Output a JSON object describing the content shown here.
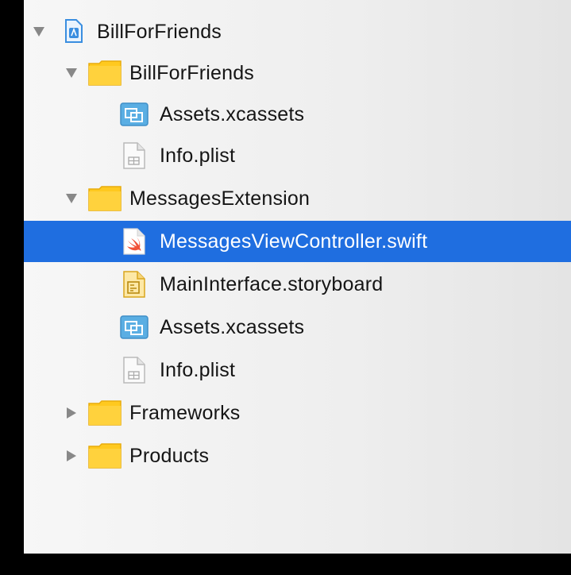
{
  "tree": {
    "project": {
      "label": "BillForFriends",
      "icon": "xcode-project-icon",
      "expanded": true
    },
    "group_app": {
      "label": "BillForFriends",
      "icon": "folder-icon",
      "expanded": true
    },
    "app_assets": {
      "label": "Assets.xcassets",
      "icon": "asset-catalog-icon"
    },
    "app_info": {
      "label": "Info.plist",
      "icon": "plist-file-icon"
    },
    "group_ext": {
      "label": "MessagesExtension",
      "icon": "folder-icon",
      "expanded": true
    },
    "ext_controller": {
      "label": "MessagesViewController.swift",
      "icon": "swift-file-icon",
      "selected": true
    },
    "ext_storyboard": {
      "label": "MainInterface.storyboard",
      "icon": "storyboard-file-icon"
    },
    "ext_assets": {
      "label": "Assets.xcassets",
      "icon": "asset-catalog-icon"
    },
    "ext_info": {
      "label": "Info.plist",
      "icon": "plist-file-icon"
    },
    "group_frameworks": {
      "label": "Frameworks",
      "icon": "folder-icon",
      "expanded": false
    },
    "group_products": {
      "label": "Products",
      "icon": "folder-icon",
      "expanded": false
    }
  },
  "colors": {
    "selection": "#1f6ee0",
    "folder": "#ffc91f",
    "asset_catalog": "#5aaee3",
    "swift": "#f05138"
  }
}
